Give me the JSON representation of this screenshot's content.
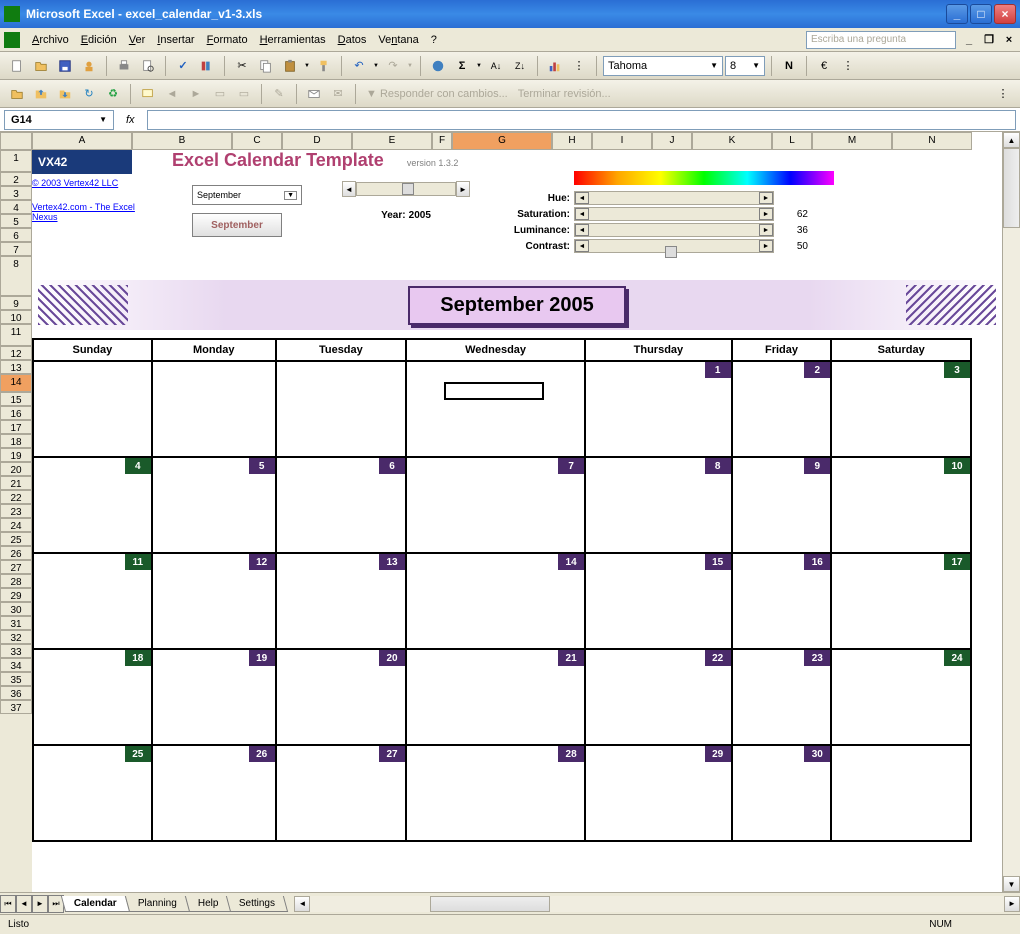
{
  "window": {
    "title": "Microsoft Excel - excel_calendar_v1-3.xls"
  },
  "menu": {
    "archivo": "Archivo",
    "edicion": "Edición",
    "ver": "Ver",
    "insertar": "Insertar",
    "formato": "Formato",
    "herramientas": "Herramientas",
    "datos": "Datos",
    "ventana": "Ventana",
    "ayuda": "?",
    "search_placeholder": "Escriba una pregunta"
  },
  "toolbar2": {
    "font": "Tahoma",
    "size": "8",
    "bold": "N",
    "euro": "€",
    "responder": "Responder con cambios...",
    "terminar": "Terminar revisión..."
  },
  "namebox": {
    "cell": "G14",
    "fx": "fx"
  },
  "columns": [
    "A",
    "B",
    "C",
    "D",
    "E",
    "F",
    "G",
    "H",
    "I",
    "J",
    "K",
    "L",
    "M",
    "N"
  ],
  "rows_1": [
    "1",
    "2",
    "3",
    "4",
    "5",
    "6",
    "7",
    "8",
    "9",
    "10",
    "11",
    "12",
    "13",
    "14",
    "15",
    "16",
    "17",
    "18",
    "19",
    "20",
    "21",
    "22",
    "23",
    "24",
    "25",
    "26",
    "27",
    "28",
    "29",
    "30",
    "31",
    "32",
    "33",
    "34",
    "35",
    "36",
    "37"
  ],
  "template": {
    "logo": "VX42",
    "copyright": "© 2003 Vertex42 LLC",
    "link2": "Vertex42.com - The Excel Nexus",
    "title": "Excel Calendar Template",
    "version": "version 1.3.2",
    "month_select": "September",
    "month_button": "September",
    "year_label": "Year:",
    "year": "2005",
    "hue": "Hue:",
    "saturation": "Saturation:",
    "saturation_val": "62",
    "luminance": "Luminance:",
    "luminance_val": "36",
    "contrast": "Contrast:",
    "contrast_val": "50"
  },
  "calendar": {
    "title": "September 2005",
    "days": [
      "Sunday",
      "Monday",
      "Tuesday",
      "Wednesday",
      "Thursday",
      "Friday",
      "Saturday"
    ],
    "weeks": [
      [
        null,
        null,
        null,
        null,
        {
          "n": "1",
          "c": "purple"
        },
        {
          "n": "2",
          "c": "purple"
        },
        {
          "n": "3",
          "c": "green"
        }
      ],
      [
        {
          "n": "4",
          "c": "green"
        },
        {
          "n": "5",
          "c": "purple"
        },
        {
          "n": "6",
          "c": "purple"
        },
        {
          "n": "7",
          "c": "purple"
        },
        {
          "n": "8",
          "c": "purple"
        },
        {
          "n": "9",
          "c": "purple"
        },
        {
          "n": "10",
          "c": "green"
        }
      ],
      [
        {
          "n": "11",
          "c": "green"
        },
        {
          "n": "12",
          "c": "purple"
        },
        {
          "n": "13",
          "c": "purple"
        },
        {
          "n": "14",
          "c": "purple"
        },
        {
          "n": "15",
          "c": "purple"
        },
        {
          "n": "16",
          "c": "purple"
        },
        {
          "n": "17",
          "c": "green"
        }
      ],
      [
        {
          "n": "18",
          "c": "green"
        },
        {
          "n": "19",
          "c": "purple"
        },
        {
          "n": "20",
          "c": "purple"
        },
        {
          "n": "21",
          "c": "purple"
        },
        {
          "n": "22",
          "c": "purple"
        },
        {
          "n": "23",
          "c": "purple"
        },
        {
          "n": "24",
          "c": "green"
        }
      ],
      [
        {
          "n": "25",
          "c": "green"
        },
        {
          "n": "26",
          "c": "purple"
        },
        {
          "n": "27",
          "c": "purple"
        },
        {
          "n": "28",
          "c": "purple"
        },
        {
          "n": "29",
          "c": "purple"
        },
        {
          "n": "30",
          "c": "purple"
        },
        null
      ]
    ]
  },
  "tabs": {
    "calendar": "Calendar",
    "planning": "Planning",
    "help": "Help",
    "settings": "Settings"
  },
  "status": {
    "ready": "Listo",
    "num": "NUM"
  }
}
